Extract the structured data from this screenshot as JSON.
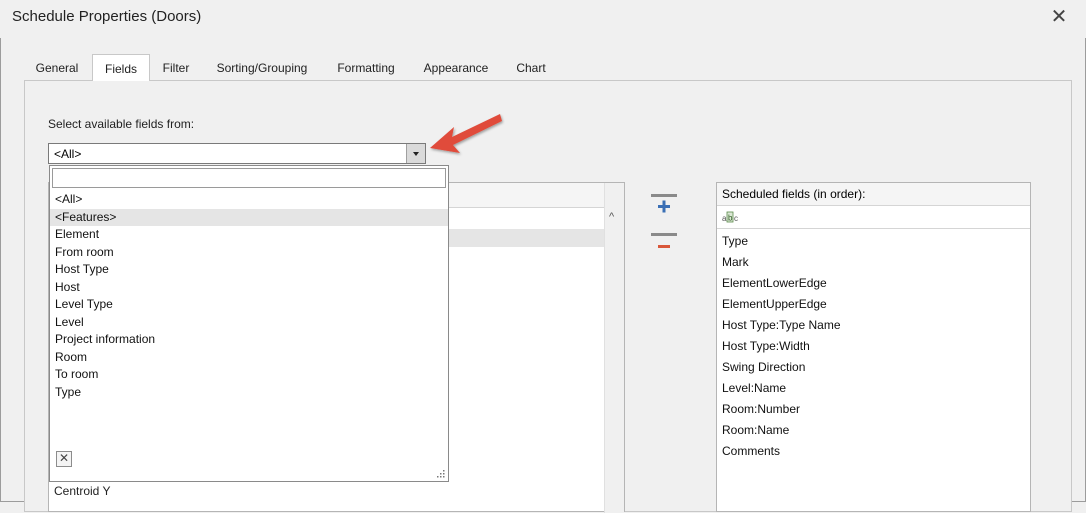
{
  "window": {
    "title": "Schedule Properties (Doors)",
    "close_label": "✕"
  },
  "tabs": [
    {
      "label": "General"
    },
    {
      "label": "Fields"
    },
    {
      "label": "Filter"
    },
    {
      "label": "Sorting/Grouping"
    },
    {
      "label": "Formatting"
    },
    {
      "label": "Appearance"
    },
    {
      "label": "Chart"
    }
  ],
  "active_tab": "Fields",
  "fields_from": {
    "label": "Select available fields from:",
    "value": "<All>"
  },
  "dropdown": {
    "search_value": "",
    "items": [
      "<All>",
      "<Features>",
      "Element",
      "From room",
      "Host Type",
      "Host",
      "Level Type",
      "Level",
      "Project information",
      "Room",
      "To room",
      "Type"
    ],
    "hovered_item": "<Features>",
    "clear_label": "✕"
  },
  "available_fields": {
    "visible_item": "Centroid Y"
  },
  "scheduled_fields": {
    "header": "Scheduled fields (in order):",
    "items": [
      "Type",
      "Mark",
      "ElementLowerEdge",
      "ElementUpperEdge",
      "Host Type:Type Name",
      "Host Type:Width",
      "Swing Direction",
      "Level:Name",
      "Room:Number",
      "Room:Name",
      "Comments"
    ]
  },
  "icons": {
    "add": "add-field-icon",
    "remove": "remove-field-icon",
    "filter": "abc-filter-icon",
    "annotation": "red-arrow-icon"
  },
  "colors": {
    "add_accent": "#3a6fb5",
    "remove_accent": "#d9573a",
    "arrow": "#e04b3a"
  }
}
